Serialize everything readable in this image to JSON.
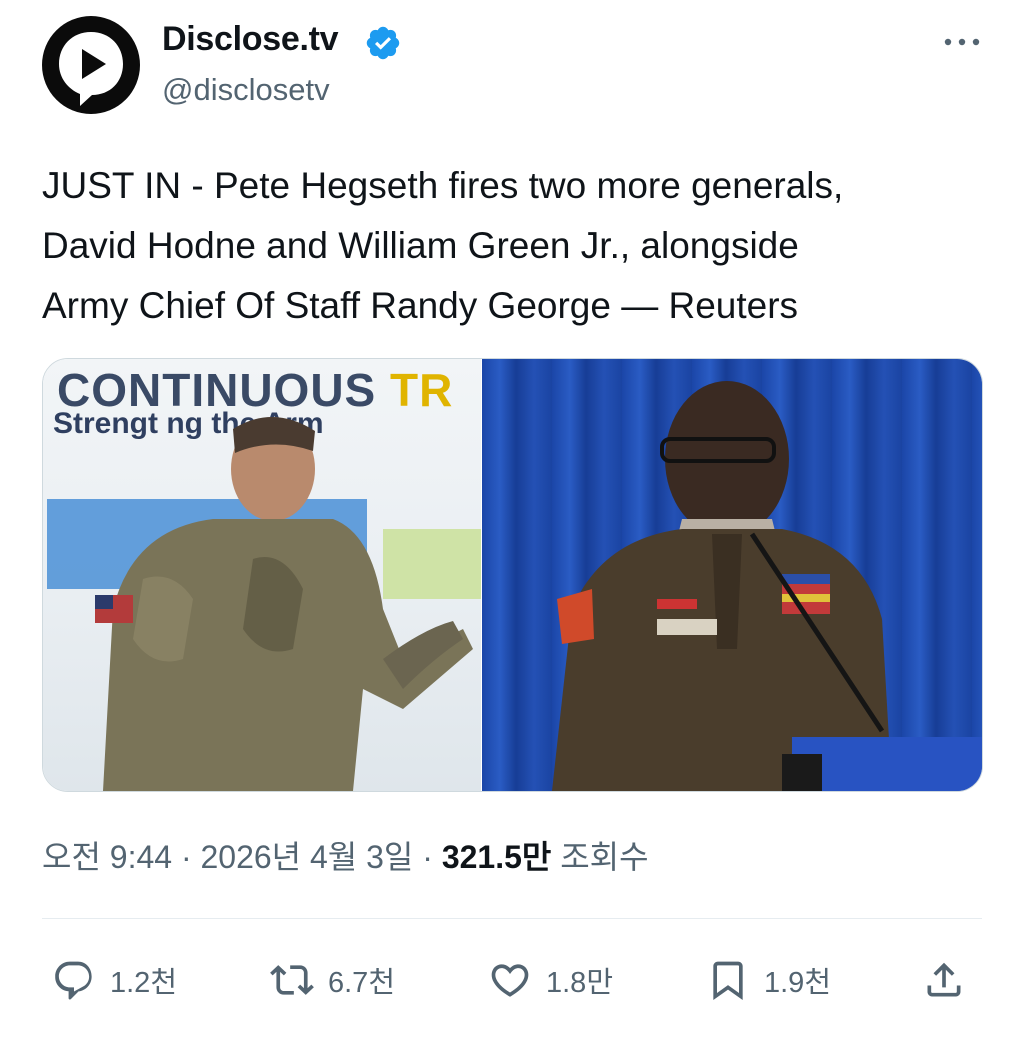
{
  "author": {
    "display_name": "Disclose.tv",
    "handle": "@disclosetv",
    "verified": true
  },
  "tweet": {
    "text": "JUST IN - Pete Hegseth fires two more generals,\nDavid Hodne and William Green Jr., alongside\nArmy Chief Of Staff Randy George — Reuters"
  },
  "media": {
    "left_image": {
      "slide_title": "CONTINUOUS",
      "slide_title_accent": "TR",
      "slide_subtitle": "Strengt    ng the Arm"
    }
  },
  "meta": {
    "time_date": "오전 9:44 · 2026년 4월 3일 · ",
    "views_count": "321.5만",
    "views_label": " 조회수"
  },
  "actions": {
    "replies": "1.2천",
    "reposts": "6.7천",
    "likes": "1.8만",
    "bookmarks": "1.9천"
  },
  "colors": {
    "verified_blue": "#1d9bf0",
    "secondary_text": "#536471",
    "primary_text": "#0f1419"
  },
  "icons": [
    "play-logo-icon",
    "verified-badge-icon",
    "more-icon",
    "reply-icon",
    "repost-icon",
    "like-icon",
    "bookmark-icon",
    "share-icon"
  ]
}
